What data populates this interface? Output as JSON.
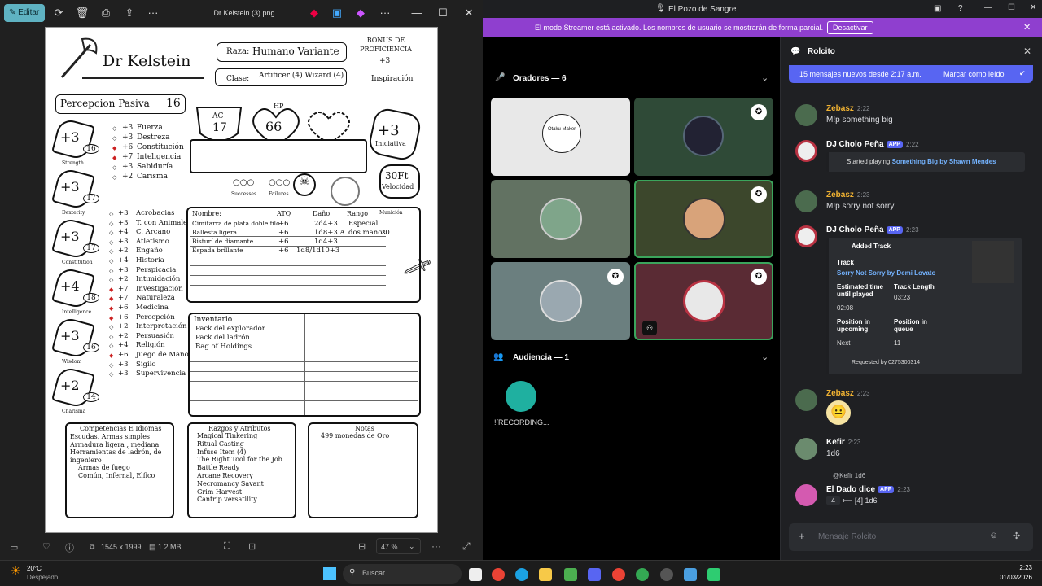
{
  "photos": {
    "edit_label": "Editar",
    "file_title": "Dr Kelstein (3).png",
    "dimensions": "1545 x 1999",
    "filesize": "1.2 MB",
    "zoom": "47 %"
  },
  "sheet": {
    "name": "Dr Kelstein",
    "race_label": "Raza:",
    "race": "Humano Variante",
    "class_label": "Clase:",
    "class": "Artificer (4) Wizard (4)",
    "prof_title": "BONUS DE PROFICIENCIA",
    "prof_value": "+3",
    "inspiration": "Inspiración",
    "passive_label": "Percepcion Pasiva",
    "passive_value": "16",
    "ac_label": "AC",
    "ac": "17",
    "hp_label": "HP",
    "hp": "66",
    "initiative": "+3",
    "initiative_label": "Iniciativa",
    "speed": "30Ft",
    "speed_label": "Velocidad",
    "successes": "Successes",
    "failures": "Failures",
    "abilities": [
      {
        "label": "Strength",
        "mod": "+3",
        "score": "16"
      },
      {
        "label": "Dexterity",
        "mod": "+3",
        "score": "17"
      },
      {
        "label": "Constitution",
        "mod": "+3",
        "score": "17"
      },
      {
        "label": "Intelligence",
        "mod": "+4",
        "score": "18"
      },
      {
        "label": "Wisdom",
        "mod": "+3",
        "score": "16"
      },
      {
        "label": "Charisma",
        "mod": "+2",
        "score": "14"
      }
    ],
    "saves": [
      [
        "+3",
        "Fuerza"
      ],
      [
        "+3",
        "Destreza"
      ],
      [
        "+6",
        "Constitución"
      ],
      [
        "+7",
        "Inteligencia"
      ],
      [
        "+3",
        "Sabiduría"
      ],
      [
        "+2",
        "Carisma"
      ]
    ],
    "skills": [
      [
        "+3",
        "Acrobacias"
      ],
      [
        "+3",
        "T. con Animales"
      ],
      [
        "+4",
        "C. Arcano"
      ],
      [
        "+3",
        "Atletismo"
      ],
      [
        "+2",
        "Engaño"
      ],
      [
        "+4",
        "Historia"
      ],
      [
        "+3",
        "Perspicacia"
      ],
      [
        "+2",
        "Intimidación"
      ],
      [
        "+7",
        "Investigación"
      ],
      [
        "+7",
        "Naturaleza"
      ],
      [
        "+6",
        "Medicina"
      ],
      [
        "+6",
        "Percepción"
      ],
      [
        "+2",
        "Interpretación"
      ],
      [
        "+2",
        "Persuasión"
      ],
      [
        "+4",
        "Religión"
      ],
      [
        "+6",
        "Juego de Manos"
      ],
      [
        "+3",
        "Sigilo"
      ],
      [
        "+3",
        "Supervivencia"
      ]
    ],
    "weapons_headers": [
      "Nombre:",
      "ATQ",
      "Daño",
      "Rango",
      "Munición"
    ],
    "weapons": [
      [
        "Cimitarra de plata doble filo",
        "+6",
        "2d4+3",
        "Especial",
        ""
      ],
      [
        "Ballesta ligera",
        "+6",
        "1d8+3 A",
        "dos manos",
        "20"
      ],
      [
        "Bisturí de diamante",
        "+6",
        "1d4+3",
        "",
        ""
      ],
      [
        "Espada brillante",
        "+6",
        "1d8/1d10+3",
        "",
        ""
      ]
    ],
    "inventory_title": "Inventario",
    "inventory": [
      "Pack del explorador",
      "Pack del ladrón",
      "Bag of Holdings"
    ],
    "comp_title": "Competencias E Idiomas",
    "comp": [
      "Escudas, Armas simples",
      "Armadura ligera , mediana",
      "Herramientas de ladrón, de",
      "ingeniero",
      "Armas de fuego",
      "Común, Infernal, Elfico"
    ],
    "traits_title": "Razgos y Atributos",
    "traits": [
      "Magical Tinkering",
      "Ritual Casting",
      "Infuse Item (4)",
      "The Right Tool for the Job",
      "Battle Ready",
      "Arcane Recovery",
      "Necromancy Savant",
      "Grim Harvest",
      "Cantrip versatility"
    ],
    "notes_title": "Notas",
    "notes": [
      "499 monedas de Oro"
    ]
  },
  "discord": {
    "server_title": "El Pozo de Sangre",
    "streamer_text": "El modo Streamer está activado. Los nombres de usuario se mostrarán de forma parcial.",
    "streamer_btn": "Desactivar",
    "speakers_label": "Oradores — 6",
    "audience_label": "Audiencia — 1",
    "audience_name": "![RECORDING...",
    "tile1_text": "Otaku Maker",
    "channel": "Rolcito",
    "new_msgs": "15 mensajes nuevos desde 2:17 a.m.",
    "mark_read": "Marcar como leído",
    "messages": [
      {
        "name": "Zebasz",
        "time": "2:22",
        "text": "M!p something big"
      },
      {
        "name": "DJ Cholo Peña",
        "app": "APP",
        "time": "2:22",
        "embed_prefix": "Started playing ",
        "embed_link": "Something Big by Shawn Mendes"
      },
      {
        "name": "Zebasz",
        "time": "2:23",
        "text": "M!p sorry not sorry"
      },
      {
        "name": "DJ Cholo Peña",
        "app": "APP",
        "time": "2:23",
        "added": "Added Track",
        "track_label": "Track",
        "track": "Sorry Not Sorry by Demi Lovato",
        "est_label": "Estimated time until played",
        "est": "02:08",
        "len_label": "Track Length",
        "len": "03:23",
        "pos_up_label": "Position in upcoming",
        "pos_up": "Next",
        "pos_q_label": "Position in queue",
        "pos_q": "11",
        "requested": "Requested by 0275300314"
      },
      {
        "name": "Zebasz",
        "time": "2:23"
      },
      {
        "name": "Kefir",
        "time": "2:23",
        "text": "1d6"
      },
      {
        "name": "El Dado dice",
        "app": "APP",
        "time": "2:23",
        "reply": "@Kefir 1d6",
        "roll_box": "4",
        "roll_text": "⟵ [4] 1d6"
      }
    ],
    "input_placeholder": "Mensaje Rolcito"
  },
  "taskbar": {
    "temp": "20°C",
    "weather": "Despejado",
    "search": "Buscar",
    "time": "2:23",
    "date": "01/03/2026"
  }
}
